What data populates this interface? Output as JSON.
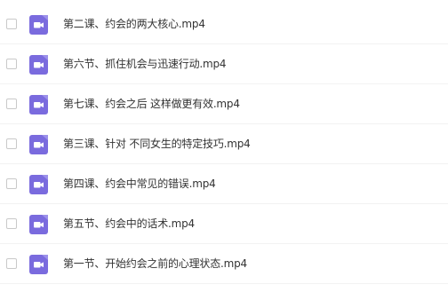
{
  "file_list": {
    "file_icon": "video-file-icon",
    "icon_color": "#7a6bde",
    "items": [
      {
        "name": "第二课、约会的两大核心.mp4"
      },
      {
        "name": "第六节、抓住机会与迅速行动.mp4"
      },
      {
        "name": "第七课、约会之后 这样做更有效.mp4"
      },
      {
        "name": "第三课、针对 不同女生的特定技巧.mp4"
      },
      {
        "name": "第四课、约会中常见的错误.mp4"
      },
      {
        "name": "第五节、约会中的话术.mp4"
      },
      {
        "name": "第一节、开始约会之前的心理状态.mp4"
      }
    ]
  }
}
